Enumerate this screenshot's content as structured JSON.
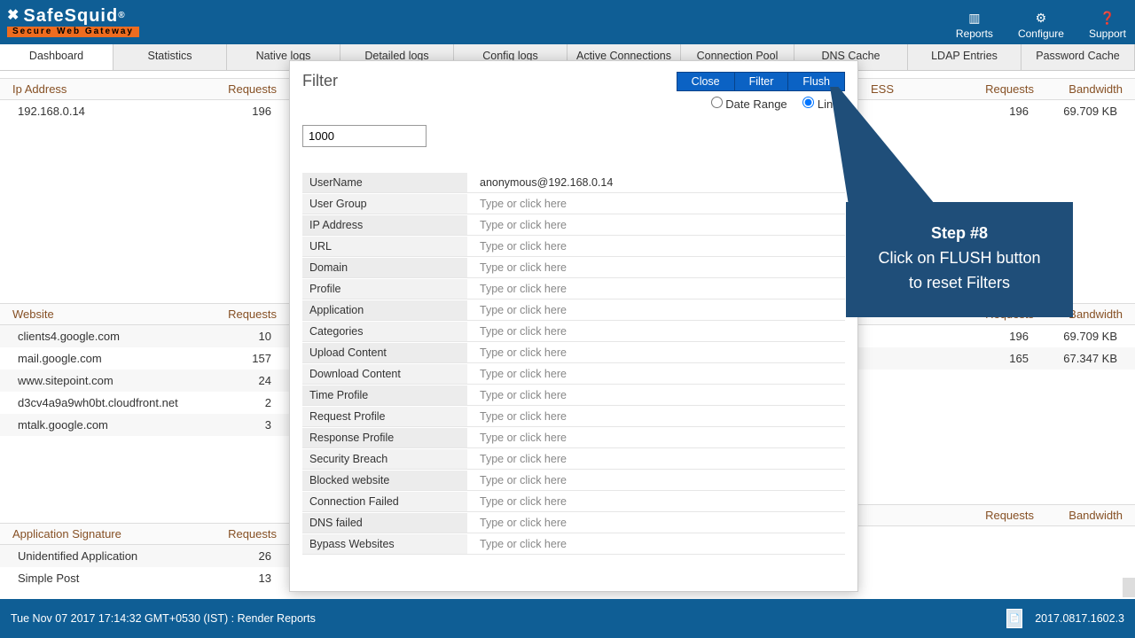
{
  "brand": {
    "name": "SafeSquid",
    "reg": "®",
    "tagline": "Secure Web Gateway"
  },
  "header_actions": {
    "reports": "Reports",
    "configure": "Configure",
    "support": "Support"
  },
  "tabs": [
    "Dashboard",
    "Statistics",
    "Native logs",
    "Detailed logs",
    "Config logs",
    "Active Connections",
    "Connection Pool",
    "DNS Cache",
    "LDAP Entries",
    "Password Cache"
  ],
  "left": {
    "ip_header": {
      "col1": "Ip Address",
      "col2": "Requests"
    },
    "ip_rows": [
      {
        "a": "192.168.0.14",
        "b": "196"
      }
    ],
    "website_header": {
      "col1": "Website",
      "col2": "Requests"
    },
    "website_rows": [
      {
        "a": "clients4.google.com",
        "b": "10"
      },
      {
        "a": "mail.google.com",
        "b": "157"
      },
      {
        "a": "www.sitepoint.com",
        "b": "24"
      },
      {
        "a": "d3cv4a9a9wh0bt.cloudfront.net",
        "b": "2"
      },
      {
        "a": "mtalk.google.com",
        "b": "3"
      }
    ],
    "app_header": {
      "col1": "Application Signature",
      "col2": "Requests"
    },
    "app_rows": [
      {
        "a": "Unidentified Application",
        "b": "26"
      },
      {
        "a": "Simple Post",
        "b": "13"
      }
    ]
  },
  "right": {
    "top_header": {
      "c1": "ESS",
      "c2": "Requests",
      "c3": "Bandwidth"
    },
    "top_rows": [
      {
        "b": "196",
        "c": "69.709 KB"
      }
    ],
    "mid_header": {
      "c2": "Requests",
      "c3": "Bandwidth"
    },
    "mid_rows": [
      {
        "b": "196",
        "c": "69.709 KB"
      },
      {
        "b": "165",
        "c": "67.347 KB"
      }
    ],
    "bot_header": {
      "c2": "Requests",
      "c3": "Bandwidth"
    }
  },
  "modal": {
    "title": "Filter",
    "buttons": {
      "close": "Close",
      "filter": "Filter",
      "flush": "Flush"
    },
    "radio": {
      "date_range": "Date Range",
      "lines": "Lines"
    },
    "limit_value": "1000",
    "placeholder": "Type or click here",
    "fields": [
      {
        "label": "UserName",
        "value": "anonymous@192.168.0.14"
      },
      {
        "label": "User Group",
        "value": ""
      },
      {
        "label": "IP Address",
        "value": ""
      },
      {
        "label": "URL",
        "value": ""
      },
      {
        "label": "Domain",
        "value": ""
      },
      {
        "label": "Profile",
        "value": ""
      },
      {
        "label": "Application",
        "value": ""
      },
      {
        "label": "Categories",
        "value": ""
      },
      {
        "label": "Upload Content",
        "value": ""
      },
      {
        "label": "Download Content",
        "value": ""
      },
      {
        "label": "Time Profile",
        "value": ""
      },
      {
        "label": "Request Profile",
        "value": ""
      },
      {
        "label": "Response Profile",
        "value": ""
      },
      {
        "label": "Security Breach",
        "value": ""
      },
      {
        "label": "Blocked website",
        "value": ""
      },
      {
        "label": "Connection Failed",
        "value": ""
      },
      {
        "label": "DNS failed",
        "value": ""
      },
      {
        "label": "Bypass Websites",
        "value": ""
      }
    ]
  },
  "callout": {
    "step": "Step #8",
    "line2": "Click on FLUSH button",
    "line3": "to reset Filters"
  },
  "footer": {
    "left": "Tue Nov 07 2017 17:14:32 GMT+0530 (IST) : Render Reports",
    "version": "2017.0817.1602.3"
  }
}
